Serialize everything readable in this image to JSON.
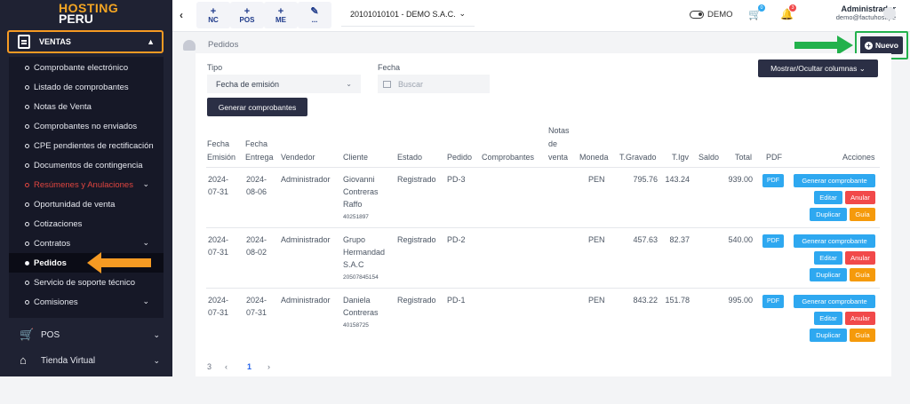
{
  "brand": {
    "line1": "HOSTING",
    "line2": "PERU"
  },
  "sidebar": {
    "section": {
      "label": "VENTAS"
    },
    "items": [
      {
        "label": "Comprobante electrónico"
      },
      {
        "label": "Listado de comprobantes"
      },
      {
        "label": "Notas de Venta"
      },
      {
        "label": "Comprobantes no enviados"
      },
      {
        "label": "CPE pendientes de rectificación"
      },
      {
        "label": "Documentos de contingencia"
      },
      {
        "label": "Resúmenes y Anulaciones"
      },
      {
        "label": "Oportunidad de venta"
      },
      {
        "label": "Cotizaciones"
      },
      {
        "label": "Contratos"
      },
      {
        "label": "Pedidos"
      },
      {
        "label": "Servicio de soporte técnico"
      },
      {
        "label": "Comisiones"
      }
    ],
    "main": [
      {
        "label": "POS"
      },
      {
        "label": "Tienda Virtual"
      }
    ]
  },
  "topbar": {
    "quick": [
      {
        "label": "NC"
      },
      {
        "label": "POS"
      },
      {
        "label": "ME"
      },
      {
        "label": "..."
      }
    ],
    "company": "20101010101 - DEMO S.A.C.",
    "mode": "DEMO",
    "cart_count": "0",
    "notif_count": "3",
    "user_name": "Administrador",
    "user_email": "demo@factuhost.pe"
  },
  "page": {
    "breadcrumb": "Pedidos",
    "new_button": "Nuevo",
    "columns_button": "Mostrar/Ocultar columnas",
    "filter": {
      "type_label": "Tipo",
      "type_value": "Fecha de emisión",
      "date_label": "Fecha",
      "date_placeholder": "Buscar"
    },
    "generate_button": "Generar comprobantes"
  },
  "table": {
    "headers": {
      "fecha_emision_1": "Fecha",
      "fecha_emision_2": "Emisión",
      "fecha_entrega_1": "Fecha",
      "fecha_entrega_2": "Entrega",
      "vendedor": "Vendedor",
      "cliente": "Cliente",
      "estado": "Estado",
      "pedido": "Pedido",
      "comprobantes": "Comprobantes",
      "notas_1": "Notas",
      "notas_2": "de",
      "notas_3": "venta",
      "moneda": "Moneda",
      "tgravado": "T.Gravado",
      "tigv": "T.Igv",
      "saldo": "Saldo",
      "total": "Total",
      "pdf": "PDF",
      "acciones": "Acciones"
    },
    "rows": [
      {
        "emision_1": "2024-",
        "emision_2": "07-31",
        "entrega_1": "2024-",
        "entrega_2": "08-06",
        "vendedor": "Administrador",
        "cliente_1": "Giovanni",
        "cliente_2": "Contreras",
        "cliente_3": "Raffo",
        "doc": "40251897",
        "estado": "Registrado",
        "pedido": "PD-3",
        "moneda": "PEN",
        "gravado": "795.76",
        "igv": "143.24",
        "total": "939.00"
      },
      {
        "emision_1": "2024-",
        "emision_2": "07-31",
        "entrega_1": "2024-",
        "entrega_2": "08-02",
        "vendedor": "Administrador",
        "cliente_1": "Grupo",
        "cliente_2": "Hermandad",
        "cliente_3": "S.A.C",
        "doc": "20507845154",
        "estado": "Registrado",
        "pedido": "PD-2",
        "moneda": "PEN",
        "gravado": "457.63",
        "igv": "82.37",
        "total": "540.00"
      },
      {
        "emision_1": "2024-",
        "emision_2": "07-31",
        "entrega_1": "2024-",
        "entrega_2": "07-31",
        "vendedor": "Administrador",
        "cliente_1": "Daniela",
        "cliente_2": "Contreras",
        "cliente_3": "",
        "doc": "40158725",
        "estado": "Registrado",
        "pedido": "PD-1",
        "moneda": "PEN",
        "gravado": "843.22",
        "igv": "151.78",
        "total": "995.00"
      }
    ],
    "actions": {
      "pdf": "PDF",
      "generate": "Generar comprobante",
      "edit": "Editar",
      "cancel": "Anular",
      "duplicate": "Duplicar",
      "guide": "Guía"
    }
  },
  "pagination": {
    "total": "3",
    "prev": "‹",
    "current": "1",
    "next": "›"
  },
  "colors": {
    "sidebar": "#1f2233",
    "accent_orange": "#f59a23",
    "accent_green": "#22b14c",
    "primary_dark": "#2b2f45",
    "info": "#2ea8f0",
    "danger": "#f1494a",
    "warning": "#f59a0b"
  }
}
